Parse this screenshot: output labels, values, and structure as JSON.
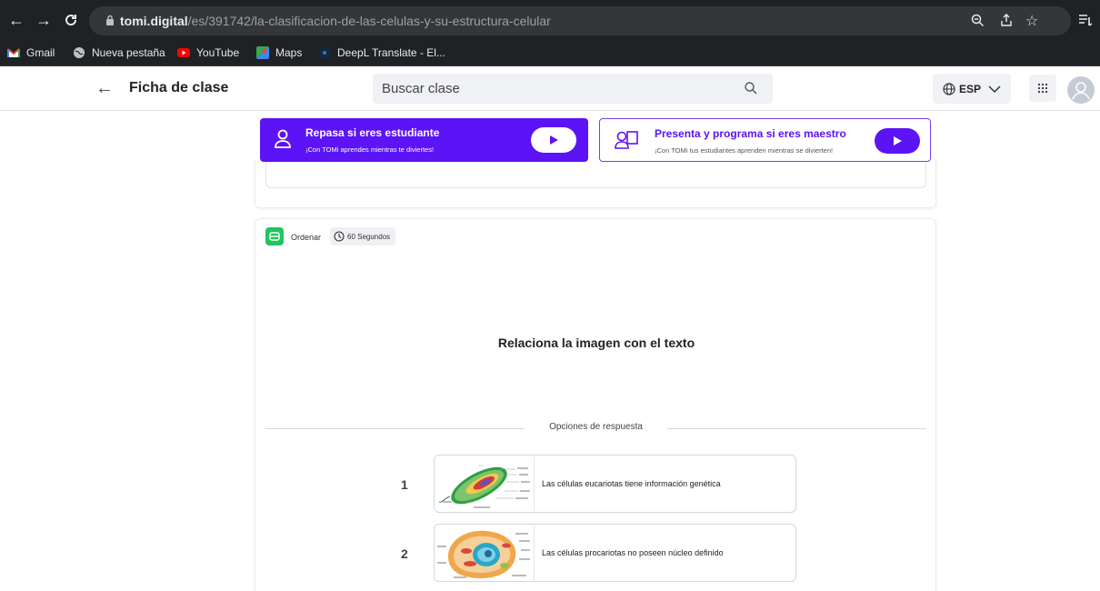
{
  "browser": {
    "url_host": "tomi.digital",
    "url_path": "/es/391742/la-clasificacion-de-las-celulas-y-su-estructura-celular",
    "bookmarks": [
      {
        "label": "Gmail",
        "icon": "gmail-icon",
        "color": "#ea4335"
      },
      {
        "label": "Nueva pestaña",
        "icon": "globe-icon",
        "color": "#bdc1c6"
      },
      {
        "label": "YouTube",
        "icon": "youtube-icon",
        "color": "#ff0000"
      },
      {
        "label": "Maps",
        "icon": "maps-icon",
        "color": "#34a853"
      },
      {
        "label": "DeepL Translate - El...",
        "icon": "deepl-icon",
        "color": "#0f2b46"
      }
    ]
  },
  "header": {
    "title": "Ficha de clase",
    "search_placeholder": "Buscar clase",
    "language": "ESP"
  },
  "promos": {
    "student": {
      "title": "Repasa si eres estudiante",
      "subtitle": "¡Con TOMi aprendes mientras te diviertes!"
    },
    "teacher": {
      "title": "Presenta y programa si eres maestro",
      "subtitle": "¡Con TOMi tus estudiantes aprenden mientras se divierten!"
    }
  },
  "colors": {
    "brand_purple": "#5c13f5",
    "badge_green": "#22c55e"
  },
  "activity": {
    "type_label": "Ordenar",
    "time_label": "60 Segundos",
    "question": "Relaciona la imagen con el texto",
    "options_label": "Opciones de respuesta",
    "options": [
      {
        "number": "1",
        "text": "Las células eucariotas tiene información genética",
        "image": "prokaryotic-cell-diagram"
      },
      {
        "number": "2",
        "text": "Las células procariotas no poseen núcleo definido",
        "image": "eukaryotic-cell-diagram"
      }
    ]
  }
}
